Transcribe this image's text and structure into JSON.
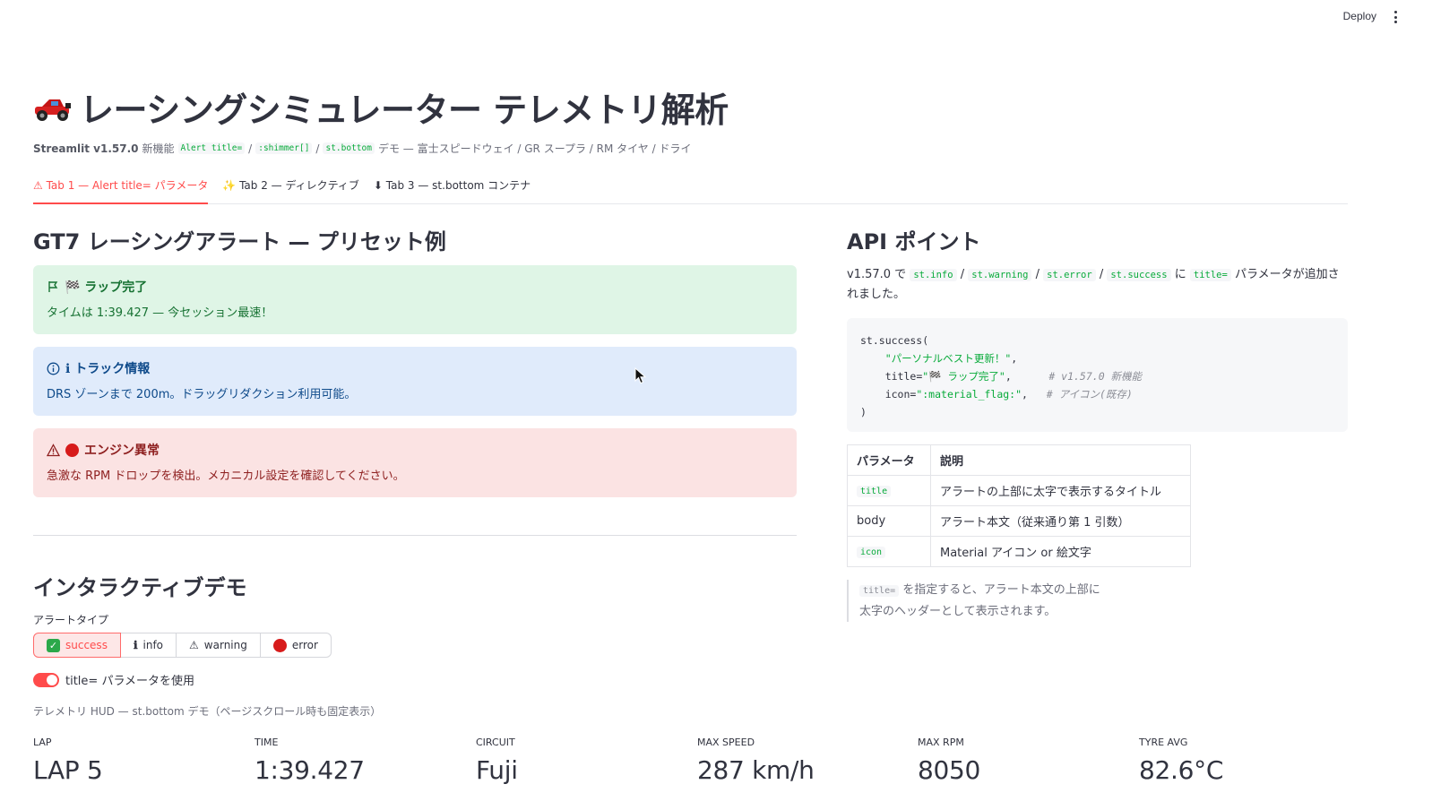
{
  "topbar": {
    "deploy_label": "Deploy"
  },
  "header": {
    "title": "レーシングシミュレーター テレメトリ解析",
    "caption_strong": "Streamlit v1.57.0",
    "caption_new": "新機能",
    "caption_code1": "Alert title=",
    "caption_sep1": "/",
    "caption_code2": ":shimmer[]",
    "caption_sep2": "/",
    "caption_code3": "st.bottom",
    "caption_rest": "デモ — 富士スピードウェイ / GR スープラ / RM タイヤ / ドライ"
  },
  "tabs": [
    {
      "label": "⚠ Tab 1 — Alert title= パラメータ",
      "active": true
    },
    {
      "label": "✨ Tab 2 — ディレクティブ",
      "active": false
    },
    {
      "label": "⬇ Tab 3 — st.bottom コンテナ",
      "active": false
    }
  ],
  "left": {
    "heading": "GT7 レーシングアラート — プリセット例",
    "alerts": {
      "success": {
        "title": "🏁 ラップ完了",
        "body": "タイムは 1:39.427 — 今セッション最速！"
      },
      "info": {
        "title": "ℹ トラック情報",
        "body": "DRS ゾーンまで 200m。ドラッグリダクション利用可能。"
      },
      "error": {
        "title": "エンジン異常",
        "body": "急激な RPM ドロップを検出。メカニカル設定を確認してください。"
      }
    },
    "demo_heading": "インタラクティブデモ",
    "alert_type_label": "アラートタイプ",
    "alert_types": {
      "success": "success",
      "info": "info",
      "warning": "warning",
      "error": "error"
    },
    "toggle_label": "title= パラメータを使用",
    "hud_caption": "テレメトリ HUD — st.bottom デモ（ページスクロール時も固定表示）",
    "metrics": [
      {
        "label": "LAP",
        "value": "LAP 5"
      },
      {
        "label": "TIME",
        "value": "1:39.427"
      },
      {
        "label": "CIRCUIT",
        "value": "Fuji"
      },
      {
        "label": "MAX SPEED",
        "value": "287 km/h"
      },
      {
        "label": "MAX RPM",
        "value": "8050"
      },
      {
        "label": "TYRE AVG",
        "value": "82.6°C"
      }
    ]
  },
  "right": {
    "heading": "API ポイント",
    "intro_pre": "v1.57.0 で",
    "intro_code1": "st.info",
    "intro_code2": "st.warning",
    "intro_code3": "st.error",
    "intro_code4": "st.success",
    "intro_mid": "に",
    "intro_code5": "title=",
    "intro_post": "パラメータが追加されました。",
    "code": {
      "l1": "st.success(",
      "l2_str": "\"パーソナルベスト更新！\"",
      "l3_key": "title=",
      "l3_str": "\"🏁 ラップ完了\"",
      "l3_comment": "# v1.57.0 新機能",
      "l4_key": "icon=",
      "l4_str": "\":material_flag:\"",
      "l4_comment": "# アイコン(既存)",
      "l5": ")"
    },
    "table": {
      "headers": [
        "パラメータ",
        "説明"
      ],
      "rows": [
        {
          "param": "title",
          "desc": "アラートの上部に太字で表示するタイトル"
        },
        {
          "param": "body",
          "desc": "アラート本文（従来通り第 1 引数）"
        },
        {
          "param": "icon",
          "desc": "Material アイコン or 絵文字"
        }
      ]
    },
    "quote_code": "title=",
    "quote_line1": "を指定すると、アラート本文の上部に",
    "quote_line2": "太字のヘッダーとして表示されます。"
  },
  "colors": {
    "primary": "#ff4b4b",
    "success_bg": "#dff5e6",
    "info_bg": "#e0ebfb",
    "error_bg": "#fbe3e3",
    "code_green": "#09ab3b"
  }
}
